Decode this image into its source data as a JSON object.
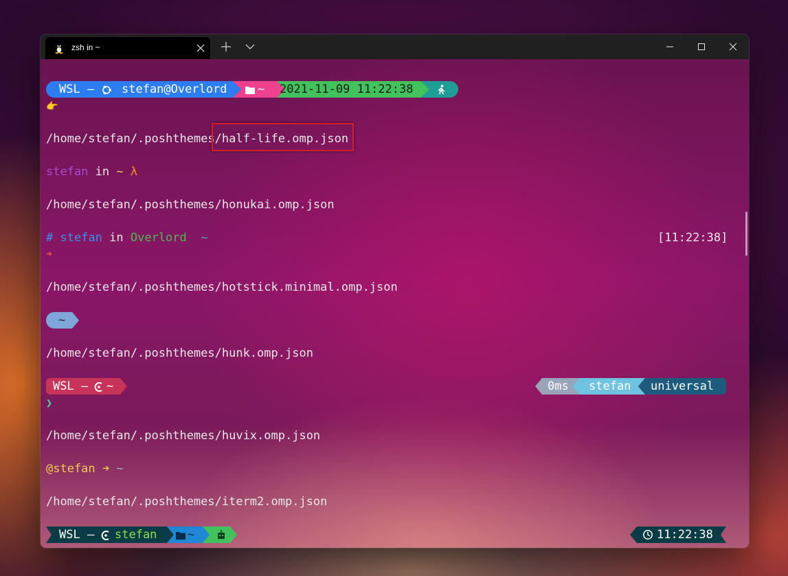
{
  "tab": {
    "title": "zsh in ~",
    "icon": "linux-tux-icon"
  },
  "titlebar": {
    "new_tab": "+",
    "dropdown": "chevron-down-icon"
  },
  "terminal": {
    "prompt1": {
      "wsl": "WSL –",
      "user_host": "stefan@Overlord",
      "path": "~",
      "datetime": "2021-11-09 11:22:38",
      "prompt_char": "👉"
    },
    "line_half_life_prefix": "/home/stefan/.poshthemes/",
    "line_half_life_file": "half-life.omp.json",
    "prompt2": {
      "user": "stefan",
      "in": " in ",
      "path": "~",
      "lambda": "λ"
    },
    "line_honukai": "/home/stefan/.poshthemes/honukai.omp.json",
    "prompt3": {
      "hash": "#",
      "user": "stefan",
      "in": " in ",
      "host": "Overlord",
      "path": "~",
      "time": "[11:22:38]",
      "arrow": "➜"
    },
    "line_hotstick": "/home/stefan/.poshthemes/hotstick.minimal.omp.json",
    "prompt4": {
      "path": "~"
    },
    "line_hunk": "/home/stefan/.poshthemes/hunk.omp.json",
    "prompt5": {
      "wsl": "WSL –",
      "path": "~",
      "exec_time": "0ms",
      "user": "stefan",
      "shell": "universal",
      "prompt_char": "❯"
    },
    "line_huvix": "/home/stefan/.poshthemes/huvix.omp.json",
    "prompt6": {
      "user": "@stefan",
      "arrow": "➜",
      "path": "~"
    },
    "line_iterm2": "/home/stefan/.poshthemes/iterm2.omp.json",
    "prompt7": {
      "wsl": "WSL –",
      "user": "stefan",
      "path": "~",
      "time": "11:22:38"
    }
  },
  "colors": {
    "blue": "#2c7ef0",
    "pink": "#f0418f",
    "green": "#41c25a",
    "teal": "#1f9d97",
    "purple_user": "#a34fd0",
    "yellow": "#f2c94c",
    "orange": "#f29b1e",
    "lightblue_pill": "#7ea6d8",
    "red_segment": "#c8335a",
    "gray_segment": "#9aa4b8",
    "cyan_segment": "#6fc3e0",
    "dark_blue_segment": "#1d5b7c",
    "dark_teal": "#0b3b45",
    "lime": "#8ee04a"
  }
}
